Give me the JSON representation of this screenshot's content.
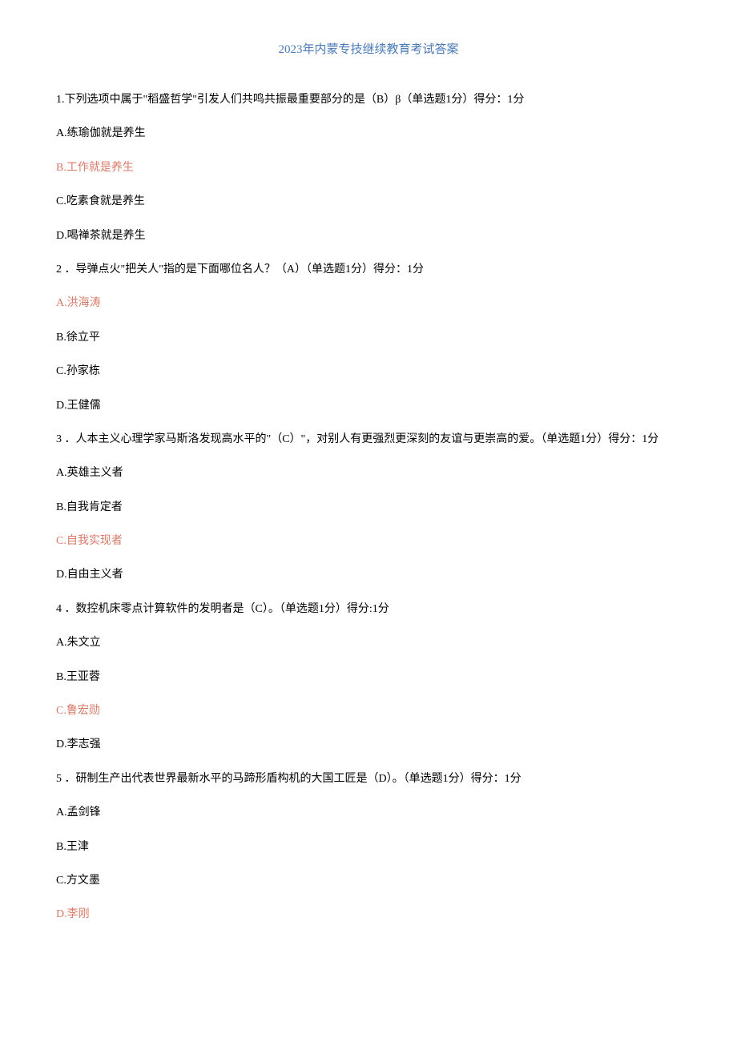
{
  "title": "2023年内蒙专技继续教育考试答案",
  "questions": [
    {
      "stem": "1.下列选项中属于\"稻盛哲学\"引发人们共鸣共振最重要部分的是（B）β（单选题1分）得分：1分",
      "options": [
        {
          "text": "A.练瑜伽就是养生",
          "highlight": false
        },
        {
          "text": "B.工作就是养生",
          "highlight": true
        },
        {
          "text": "C.吃素食就是养生",
          "highlight": false
        },
        {
          "text": "D.喝禅茶就是养生",
          "highlight": false
        }
      ]
    },
    {
      "stem": "2 ．导弹点火\"把关人\"指的是下面哪位名人？（A）（单选题1分）得分：1分",
      "options": [
        {
          "text": "A.洪海涛",
          "highlight": true
        },
        {
          "text": "B.徐立平",
          "highlight": false
        },
        {
          "text": "C.孙家栋",
          "highlight": false
        },
        {
          "text": "D.王健儒",
          "highlight": false
        }
      ]
    },
    {
      "stem": "3 ．人本主义心理学家马斯洛发现高水平的\"（C）\"，对别人有更强烈更深刻的友谊与更崇高的爱。（单选题1分）得分：1分",
      "options": [
        {
          "text": "A.英雄主义者",
          "highlight": false
        },
        {
          "text": "B.自我肯定者",
          "highlight": false
        },
        {
          "text": "C.自我实现者",
          "highlight": true
        },
        {
          "text": "D.自由主义者",
          "highlight": false
        }
      ]
    },
    {
      "stem": "4 ．数控机床零点计算软件的发明者是（C）。（单选题1分）得分:1分",
      "options": [
        {
          "text": "A.朱文立",
          "highlight": false
        },
        {
          "text": "B.王亚蓉",
          "highlight": false
        },
        {
          "text": "C.鲁宏勋",
          "highlight": true
        },
        {
          "text": "D.李志强",
          "highlight": false
        }
      ]
    },
    {
      "stem": "5 ．研制生产出代表世界最新水平的马蹄形盾构机的大国工匠是（D）。（单选题1分）得分：1分",
      "options": [
        {
          "text": "A.孟剑锋",
          "highlight": false
        },
        {
          "text": "B.王津",
          "highlight": false
        },
        {
          "text": "C.方文墨",
          "highlight": false
        },
        {
          "text": "D.李刚",
          "highlight": true
        }
      ]
    }
  ]
}
